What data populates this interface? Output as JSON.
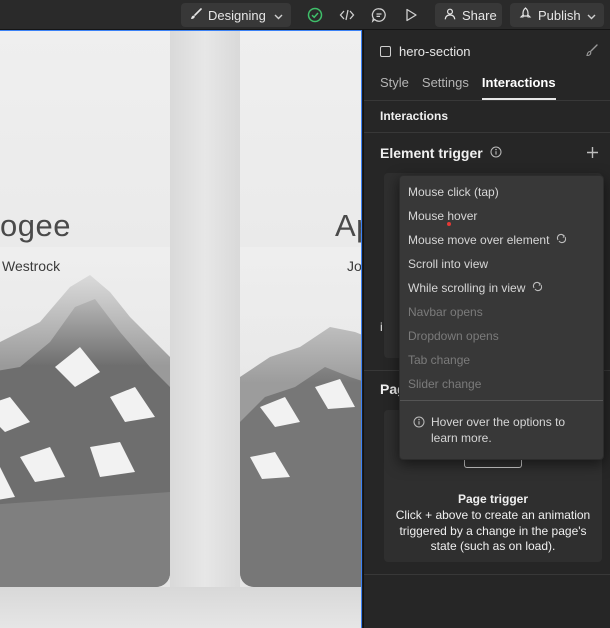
{
  "toolbar": {
    "mode_label": "Designing",
    "share_label": "Share",
    "publish_label": "Publish",
    "icons": [
      "brush-icon",
      "check-circle-icon",
      "code-icon",
      "comment-icon",
      "play-icon",
      "user-icon",
      "rocket-icon"
    ]
  },
  "canvas": {
    "left_card": {
      "title": "ogee",
      "subtitle": "Westrock"
    },
    "right_card": {
      "title": "Ap",
      "subtitle": "Jo"
    }
  },
  "panel": {
    "element_name": "hero-section",
    "tabs": [
      {
        "label": "Style",
        "active": false
      },
      {
        "label": "Settings",
        "active": false
      },
      {
        "label": "Interactions",
        "active": true
      }
    ],
    "section_title": "Interactions",
    "element_trigger_label": "Element trigger",
    "element_box_clipped_text": "i",
    "page_label_clipped": "Pag",
    "page_trigger": {
      "title": "Page trigger",
      "description": "Click + above to create an animation triggered by a change in the page's state (such as on load)."
    }
  },
  "dropdown": {
    "options": [
      {
        "label": "Mouse click (tap)",
        "disabled": false,
        "has_sub_icon": false
      },
      {
        "label": "Mouse hover",
        "disabled": false,
        "has_sub_icon": false
      },
      {
        "label": "Mouse move over element",
        "disabled": false,
        "has_sub_icon": true
      },
      {
        "label": "Scroll into view",
        "disabled": false,
        "has_sub_icon": false
      },
      {
        "label": "While scrolling in view",
        "disabled": false,
        "has_sub_icon": true
      },
      {
        "label": "Navbar opens",
        "disabled": true,
        "has_sub_icon": false
      },
      {
        "label": "Dropdown opens",
        "disabled": true,
        "has_sub_icon": false
      },
      {
        "label": "Tab change",
        "disabled": true,
        "has_sub_icon": false
      },
      {
        "label": "Slider change",
        "disabled": true,
        "has_sub_icon": false
      }
    ],
    "hint": "Hover over the options to learn more."
  },
  "colors": {
    "accent_green": "#3fbf6a",
    "selection_blue": "#3b82f6",
    "panel_bg": "#262626"
  }
}
